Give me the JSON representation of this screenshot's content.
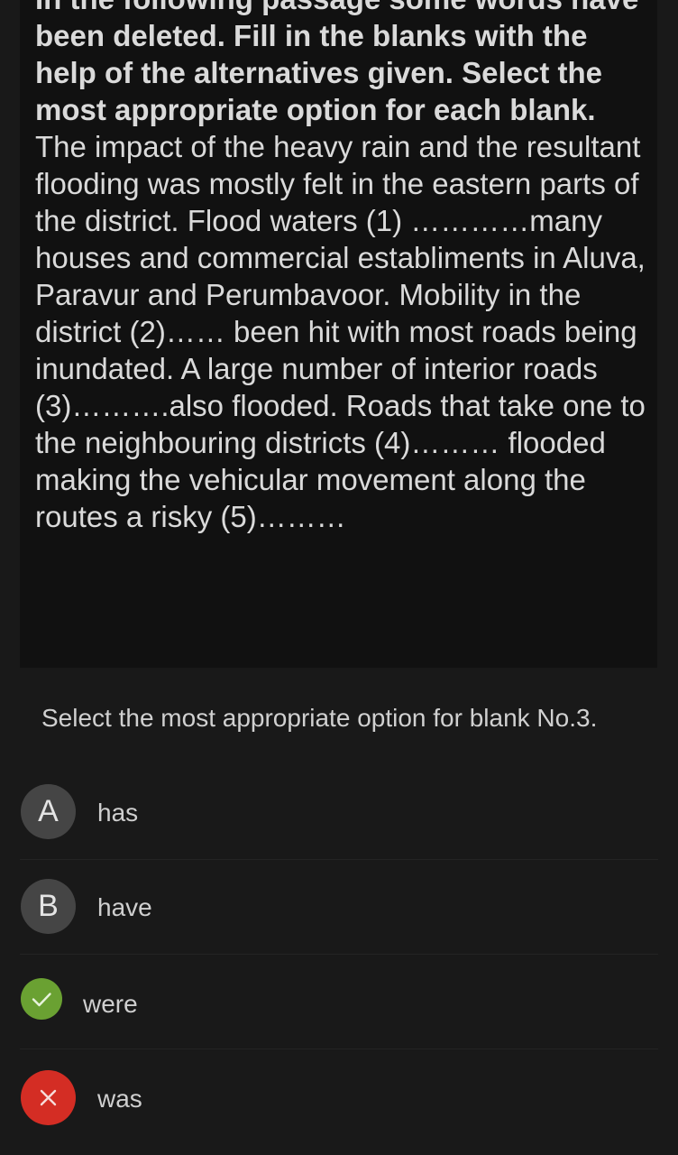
{
  "passage": {
    "instruction": "In the following passage some words have been deleted. Fill in the blanks with the help of the alternatives given. Select the most appropriate option for each blank.",
    "text": "The impact of the heavy rain and the resultant flooding was mostly felt in the eastern parts of the district. Flood waters (1) …………many houses and commercial establiments in Aluva, Paravur and Perumbavoor. Mobility in the district (2)…… been hit with most roads being inundated. A large number of interior roads (3)……….also flooded. Roads that take one to the neighbouring districts (4)……… flooded making the vehicular movement along the routes a risky (5)………"
  },
  "question": {
    "text": "Select the most appropriate option for blank No.3."
  },
  "options": [
    {
      "letter": "A",
      "text": "has",
      "state": "default",
      "icon": "letter-a-icon"
    },
    {
      "letter": "B",
      "text": "have",
      "state": "default",
      "icon": "letter-b-icon"
    },
    {
      "letter": "",
      "text": "were",
      "state": "correct",
      "icon": "check-icon"
    },
    {
      "letter": "",
      "text": "was",
      "state": "incorrect",
      "icon": "close-icon"
    }
  ],
  "colors": {
    "background": "#191919",
    "passage_background": "#111111",
    "badge_default": "#454545",
    "badge_correct": "#6aa132",
    "badge_incorrect": "#d42d24"
  }
}
